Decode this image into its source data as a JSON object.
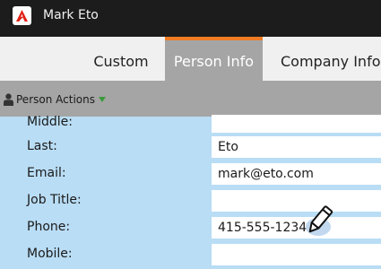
{
  "window": {
    "title": "Mark Eto"
  },
  "tabs": [
    {
      "label": "Custom"
    },
    {
      "label": "Person Info"
    },
    {
      "label": "Company Info"
    }
  ],
  "actions": {
    "label": "Person Actions"
  },
  "form": {
    "rows": [
      {
        "label": "Middle:",
        "value": ""
      },
      {
        "label": "Last:",
        "value": "Eto"
      },
      {
        "label": "Email:",
        "value": "mark@eto.com"
      },
      {
        "label": "Job Title:",
        "value": ""
      },
      {
        "label": "Phone:",
        "value": "415-555-1234"
      },
      {
        "label": "Mobile:",
        "value": ""
      }
    ]
  },
  "colors": {
    "accent": "#ef7c24",
    "form_background": "#b9ddf5",
    "titlebar": "#1c1c1c",
    "logo_red": "#e2231a"
  },
  "icons": [
    "app-logo-icon",
    "person-icon",
    "caret-down-icon",
    "pencil-cursor-icon"
  ]
}
